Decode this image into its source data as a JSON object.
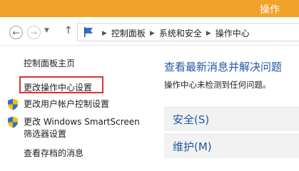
{
  "window": {
    "title": "操作"
  },
  "nav": {
    "breadcrumb": [
      "控制面板",
      "系统和安全",
      "操作中心"
    ]
  },
  "left_pane": {
    "home_link": "控制面板主页",
    "change_action_center": "更改操作中心设置",
    "change_uac": "更改用户帐户控制设置",
    "change_smartscreen_line1": "更改 Windows SmartScreen",
    "change_smartscreen_line2": "筛选器设置",
    "view_archived": "查看存档的消息"
  },
  "main": {
    "title": "查看最新消息并解决问题",
    "subtitle": "操作中心未检测到任何问题。",
    "sections": [
      {
        "label": "安全(S)"
      },
      {
        "label": "维护(M)"
      }
    ]
  },
  "colors": {
    "title_bar": "#f0a22a",
    "link_blue": "#2457a5",
    "highlight_red": "#e03131"
  }
}
